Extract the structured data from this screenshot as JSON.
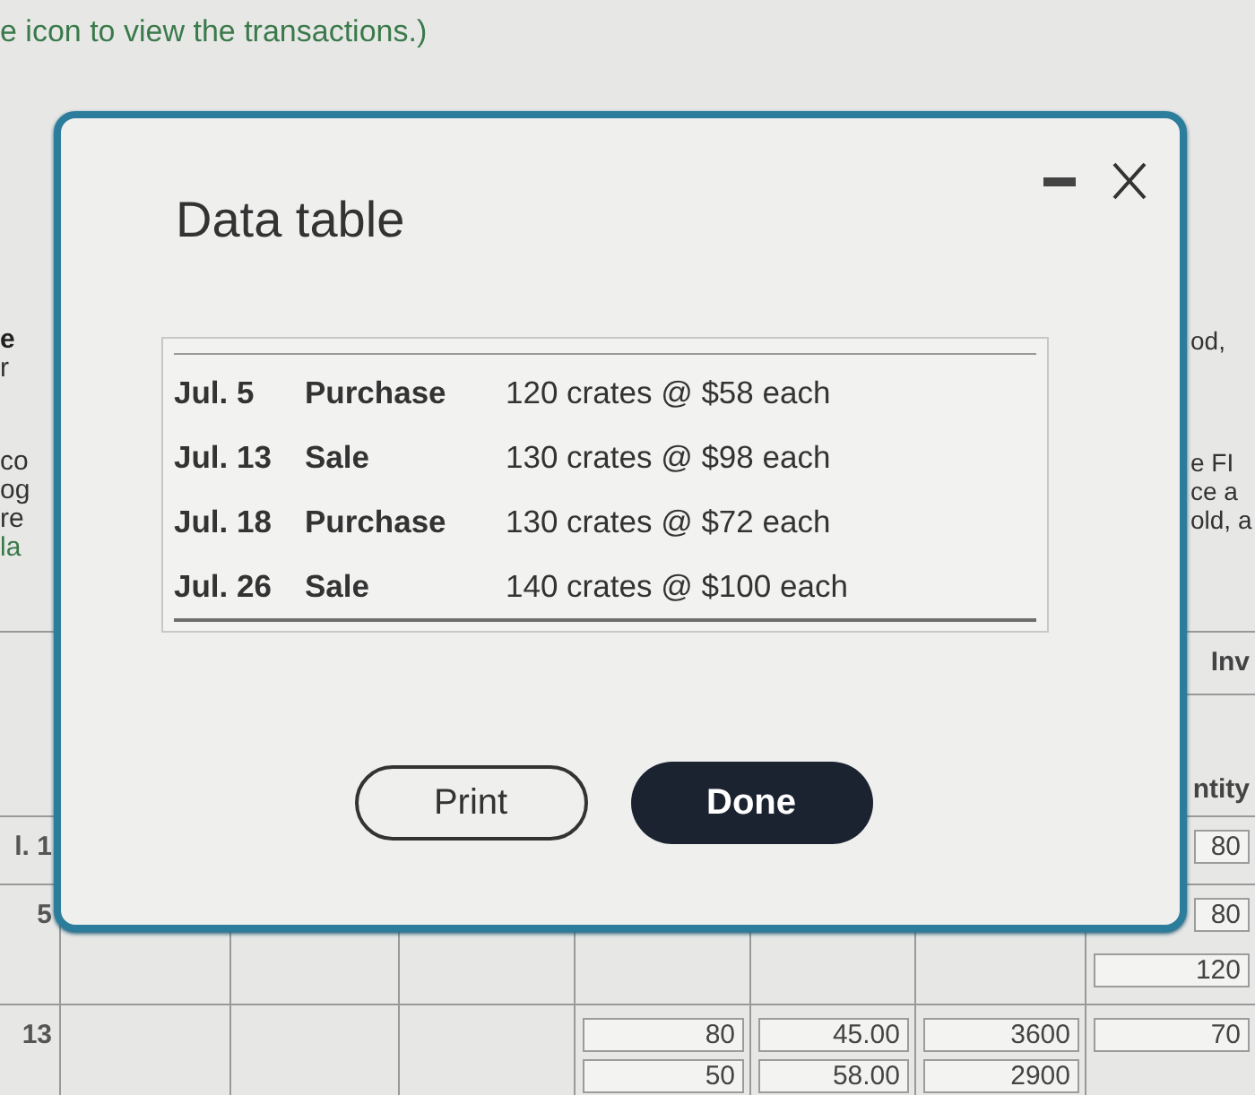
{
  "page": {
    "instruction": "e icon to view the transactions.)"
  },
  "side_text": {
    "left": [
      {
        "lines": [
          {
            "text": "e",
            "kind": "heading"
          },
          {
            "text": "r",
            "kind": "text"
          }
        ]
      },
      {
        "lines": [
          {
            "text": "co",
            "kind": "text"
          },
          {
            "text": "og",
            "kind": "text"
          },
          {
            "text": "re",
            "kind": "text"
          },
          {
            "text": "la",
            "kind": "link"
          }
        ]
      }
    ],
    "right": [
      {
        "lines": [
          {
            "text": "od,",
            "kind": "text"
          }
        ]
      },
      {
        "lines": [
          {
            "text": "e FI",
            "kind": "text"
          },
          {
            "text": "ce a",
            "kind": "text"
          },
          {
            "text": "old, a",
            "kind": "text"
          }
        ]
      }
    ]
  },
  "worksheet": {
    "header_rows": [
      {
        "column_8": "Inv"
      },
      {
        "column_8": "ntity"
      }
    ],
    "rows": [
      {
        "column_1": "l. 1",
        "column_8": [
          "80"
        ]
      },
      {
        "column_1": "5",
        "column_8": [
          "80",
          "120"
        ]
      },
      {
        "column_1": "13",
        "column_5": [
          "80",
          "50"
        ],
        "column_6": [
          "45.00",
          "58.00"
        ],
        "column_7": [
          "3600",
          "2900"
        ],
        "column_8": [
          "70"
        ]
      }
    ]
  },
  "dialog": {
    "title": "Data table",
    "transactions": [
      {
        "date": "Jul. 5",
        "type": "Purchase",
        "details": "120 crates @ $58 each"
      },
      {
        "date": "Jul. 13",
        "type": "Sale",
        "details": "130 crates @ $98 each"
      },
      {
        "date": "Jul. 18",
        "type": "Purchase",
        "details": "130 crates @ $72 each"
      },
      {
        "date": "Jul. 26",
        "type": "Sale",
        "details": "140 crates @ $100 each"
      }
    ],
    "buttons": [
      {
        "label": "Print",
        "kind": "secondary"
      },
      {
        "label": "Done",
        "kind": "primary"
      }
    ]
  }
}
